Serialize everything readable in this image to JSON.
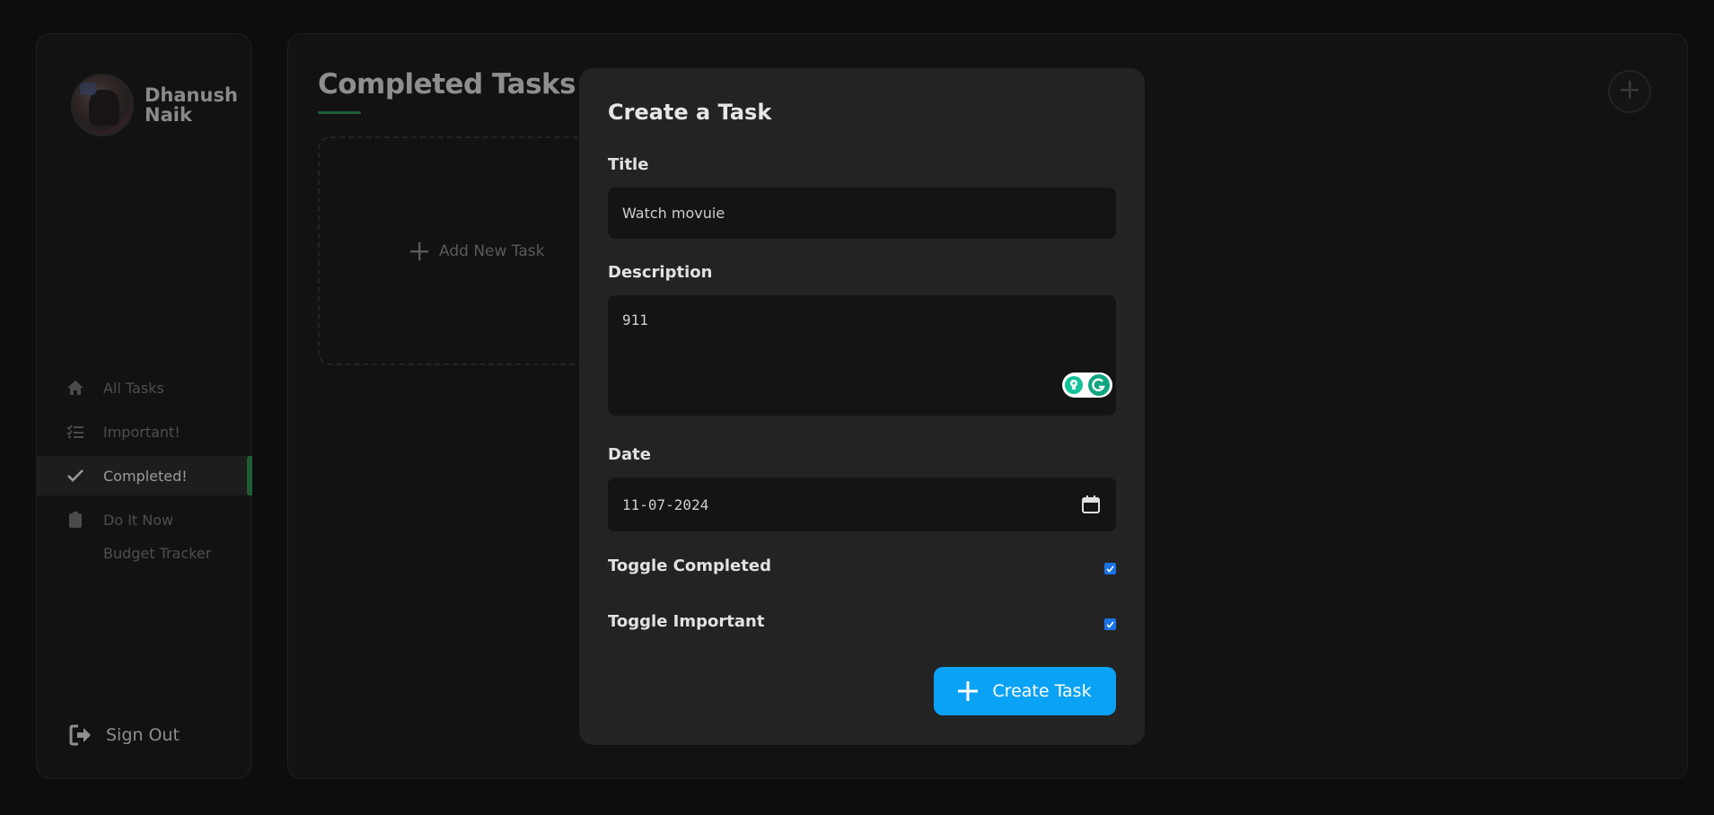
{
  "sidebar": {
    "profile": {
      "name_line1": "Dhanush",
      "name_line2": "Naik"
    },
    "nav": [
      {
        "label": "All Tasks",
        "icon": "home-icon"
      },
      {
        "label": "Important!",
        "icon": "list-check-icon"
      },
      {
        "label": "Completed!",
        "icon": "check-icon",
        "active": true
      },
      {
        "label": "Do It Now",
        "icon": "clipboard-icon"
      },
      {
        "label": "Budget Tracker"
      }
    ],
    "signout_label": "Sign Out"
  },
  "main": {
    "title": "Completed Tasks",
    "add_card_label": "Add New Task"
  },
  "modal": {
    "heading": "Create a Task",
    "title_label": "Title",
    "title_value": "Watch movuie",
    "description_label": "Description",
    "description_value": "911",
    "date_label": "Date",
    "date_value": "11-07-2024",
    "toggle_completed_label": "Toggle Completed",
    "toggle_completed_checked": true,
    "toggle_important_label": "Toggle Important",
    "toggle_important_checked": true,
    "create_button_label": "Create Task"
  },
  "colors": {
    "accent_green": "#1f5e34",
    "button_blue": "#0aa2f5",
    "checkbox_blue": "#1a73e8",
    "modal_bg": "#232323"
  }
}
